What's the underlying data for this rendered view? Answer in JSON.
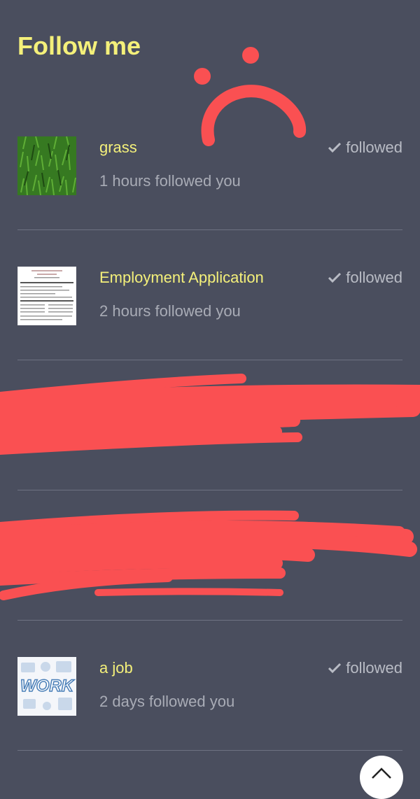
{
  "page": {
    "title": "Follow me"
  },
  "followers": [
    {
      "name": "grass",
      "time": "1 hours followed you",
      "status": "followed",
      "thumb_icon": "grass-image"
    },
    {
      "name": "Employment Application",
      "time": "2 hours followed you",
      "status": "followed",
      "thumb_icon": "document-image"
    },
    {
      "redacted": true
    },
    {
      "redacted": true
    },
    {
      "name": "a job",
      "time": "2 days followed you",
      "status": "followed",
      "thumb_icon": "work-image"
    }
  ],
  "icons": {
    "status_check": "check-icon",
    "scroll_top": "chevron-up-icon",
    "doodle": "sad-face-doodle"
  },
  "colors": {
    "background": "#4a4e5e",
    "accent_yellow": "#f4f07a",
    "muted_text": "#a9acb6",
    "divider": "#6e7282",
    "redaction_red": "#fa5052"
  }
}
